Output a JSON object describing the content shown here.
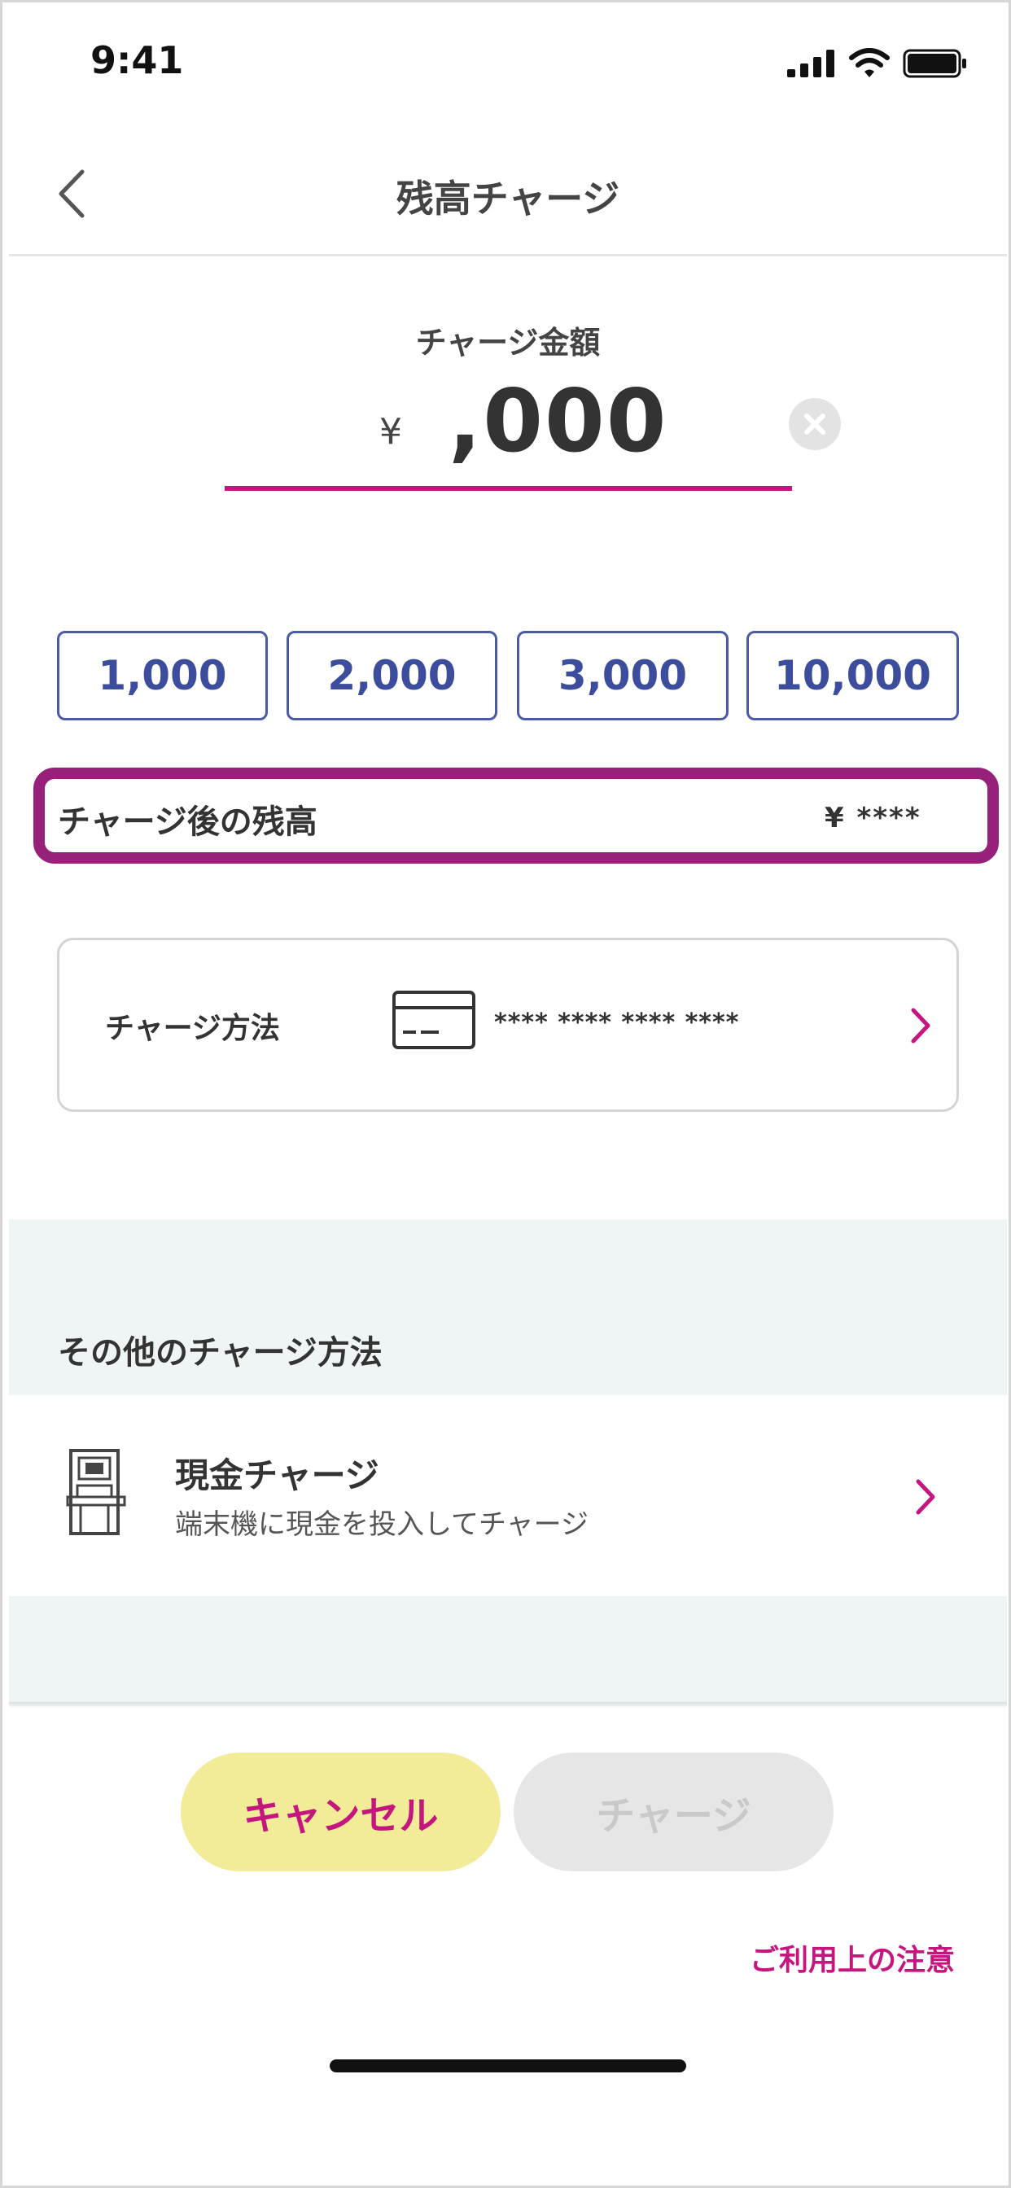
{
  "status_bar": {
    "time": "9:41"
  },
  "nav": {
    "title": "残高チャージ"
  },
  "amount": {
    "label": "チャージ金額",
    "currency": "¥",
    "value": ",000"
  },
  "quick_amounts": [
    "1,000",
    "2,000",
    "3,000",
    "10,000"
  ],
  "after_balance": {
    "label": "チャージ後の残高",
    "value": "¥ ****"
  },
  "method": {
    "label": "チャージ方法",
    "card_number": "**** **** **** ****"
  },
  "other": {
    "header": "その他のチャージ方法",
    "cash": {
      "title": "現金チャージ",
      "subtitle": "端末機に現金を投入してチャージ"
    }
  },
  "actions": {
    "cancel_label": "キャンセル",
    "charge_label": "チャージ"
  },
  "notice_link": "ご利用上の注意",
  "colors": {
    "accent": "#c4167e",
    "highlight_border": "#96207a",
    "button_blue": "#3d4d9e",
    "cancel_bg": "#f2eb98"
  }
}
